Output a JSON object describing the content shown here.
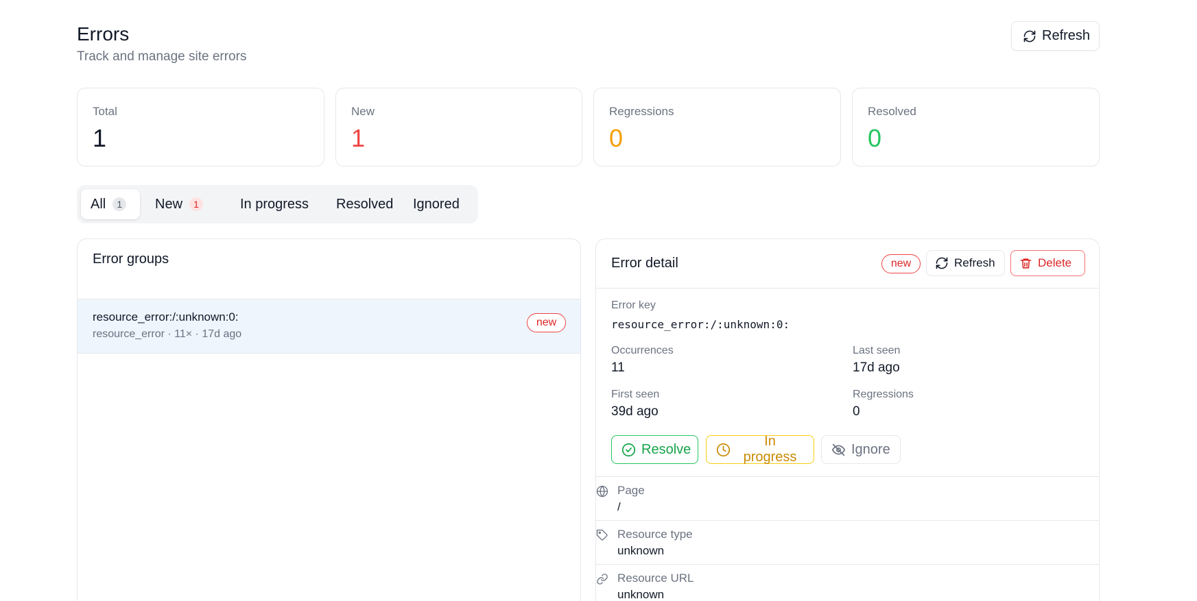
{
  "header": {
    "title": "Errors",
    "subtitle": "Track and manage site errors",
    "refresh_label": "Refresh"
  },
  "stats": [
    {
      "label": "Total",
      "value": "1",
      "color": "#111827"
    },
    {
      "label": "New",
      "value": "1",
      "color": "#ef4444"
    },
    {
      "label": "Regressions",
      "value": "0",
      "color": "#f59e0b"
    },
    {
      "label": "Resolved",
      "value": "0",
      "color": "#22c55e"
    }
  ],
  "tabs": [
    {
      "label": "All",
      "count": "1",
      "active": true
    },
    {
      "label": "New",
      "count": "1",
      "active": false
    },
    {
      "label": "In progress",
      "active": false
    },
    {
      "label": "Resolved",
      "active": false
    },
    {
      "label": "Ignored",
      "active": false
    }
  ],
  "groups_panel": {
    "title": "Error groups",
    "items": [
      {
        "key": "resource_error:/:unknown:0:",
        "meta": "resource_error · 11× · 17d ago",
        "badge": "new",
        "selected": true
      }
    ]
  },
  "detail": {
    "title": "Error detail",
    "badge": "new",
    "refresh_label": "Refresh",
    "delete_label": "Delete",
    "error_key_label": "Error key",
    "error_key": "resource_error:/:unknown:0:",
    "occurrences_label": "Occurrences",
    "occurrences": "11",
    "last_seen_label": "Last seen",
    "last_seen": "17d ago",
    "first_seen_label": "First seen",
    "first_seen": "39d ago",
    "regressions_label": "Regressions",
    "regressions": "0",
    "actions": {
      "resolve": "Resolve",
      "in_progress": "In progress",
      "ignore": "Ignore"
    },
    "meta": [
      {
        "icon": "globe-icon",
        "label": "Page",
        "value": "/"
      },
      {
        "icon": "tag-icon",
        "label": "Resource type",
        "value": "unknown"
      },
      {
        "icon": "link-icon",
        "label": "Resource URL",
        "value": "unknown"
      }
    ]
  },
  "colors": {
    "accent_red": "#dc2626",
    "accent_green": "#16a34a",
    "accent_yellow": "#ca8a04",
    "selected_row": "#eef5fd"
  }
}
